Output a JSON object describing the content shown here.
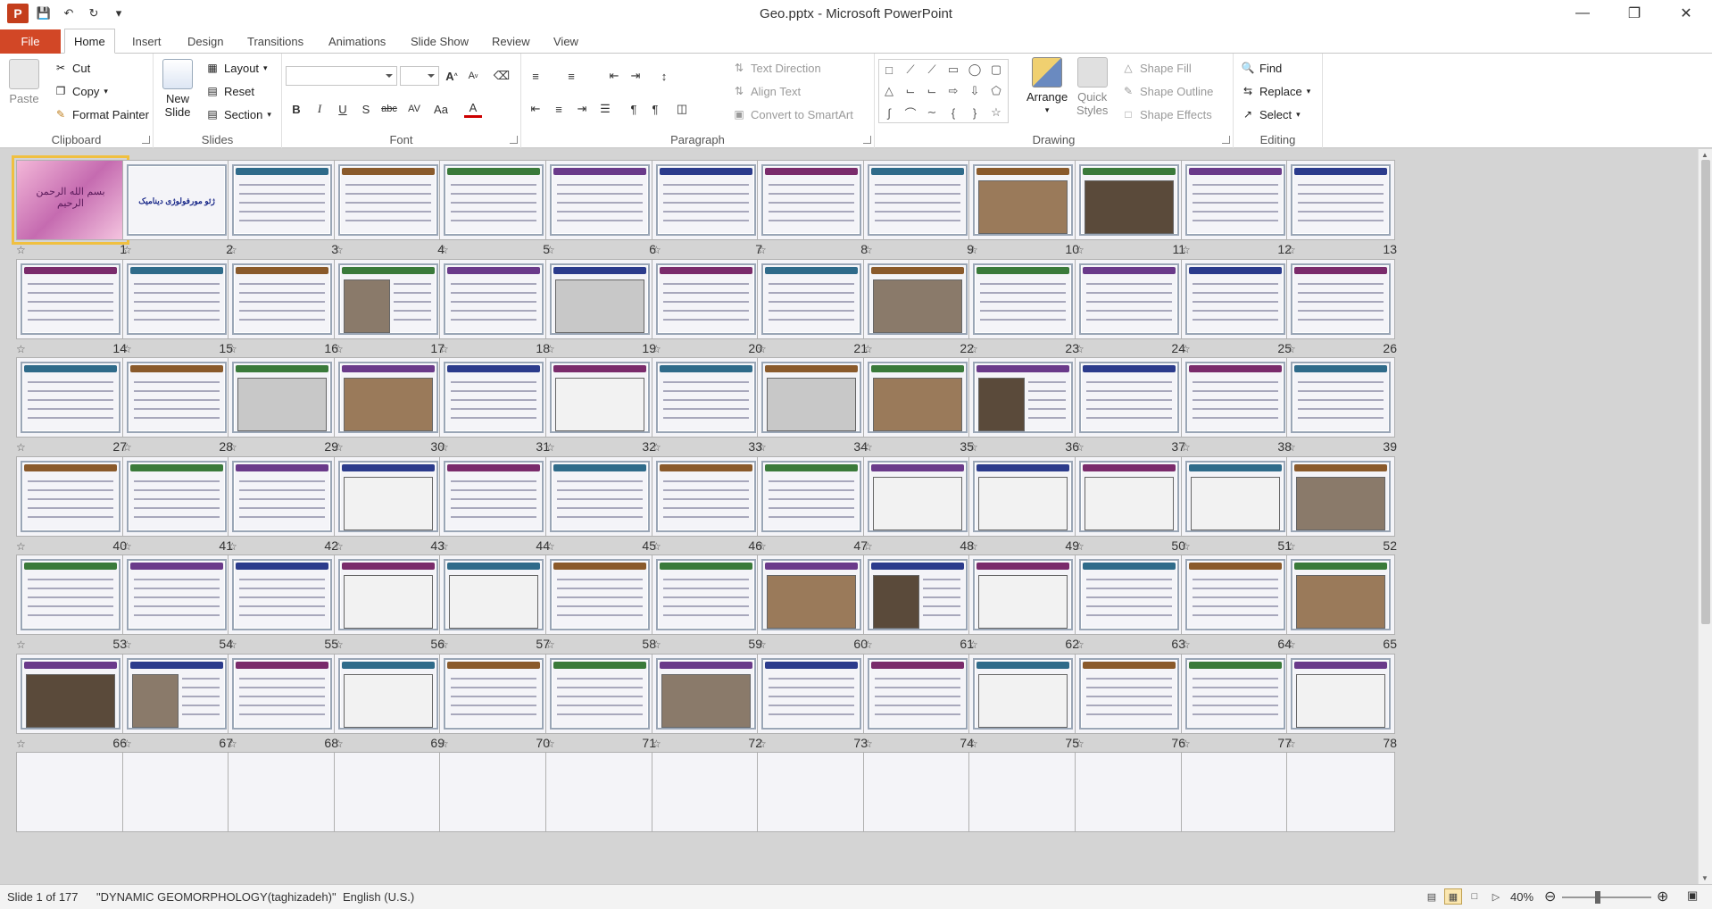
{
  "window": {
    "title": "Geo.pptx - Microsoft PowerPoint",
    "app_icon": "P",
    "controls": [
      "minimize",
      "restore",
      "close"
    ]
  },
  "quick_access": [
    "save-icon",
    "undo-icon",
    "redo-icon",
    "customize-icon"
  ],
  "tabs": [
    {
      "label": "File"
    },
    {
      "label": "Home",
      "active": true
    },
    {
      "label": "Insert"
    },
    {
      "label": "Design"
    },
    {
      "label": "Transitions"
    },
    {
      "label": "Animations"
    },
    {
      "label": "Slide Show"
    },
    {
      "label": "Review"
    },
    {
      "label": "View"
    }
  ],
  "ribbon": {
    "clipboard": {
      "label": "Clipboard",
      "paste": "Paste",
      "cut": "Cut",
      "copy": "Copy",
      "format_painter": "Format Painter"
    },
    "slides": {
      "label": "Slides",
      "new_slide_line1": "New",
      "new_slide_line2": "Slide",
      "layout": "Layout",
      "reset": "Reset",
      "section": "Section"
    },
    "font": {
      "label": "Font",
      "font_name": "",
      "font_size": "",
      "bold": "B",
      "italic": "I",
      "underline": "U",
      "strike": "S",
      "spacing": "AV",
      "case": "Aa",
      "color": "A",
      "grow": "A",
      "shrink": "A"
    },
    "paragraph": {
      "label": "Paragraph",
      "text_direction": "Text Direction",
      "align_text": "Align Text",
      "convert_smartart": "Convert to SmartArt"
    },
    "drawing": {
      "label": "Drawing",
      "arrange": "Arrange",
      "quick_styles_line1": "Quick",
      "quick_styles_line2": "Styles",
      "shape_fill": "Shape Fill",
      "shape_outline": "Shape Outline",
      "shape_effects": "Shape Effects"
    },
    "editing": {
      "label": "Editing",
      "find": "Find",
      "replace": "Replace",
      "select": "Select"
    }
  },
  "sorter": {
    "slides_visible": [
      "1",
      "2",
      "3",
      "4",
      "5",
      "6",
      "7",
      "8",
      "9",
      "10",
      "11",
      "12",
      "13",
      "14",
      "15",
      "16",
      "17",
      "18",
      "19",
      "20",
      "21",
      "22",
      "23",
      "24",
      "25",
      "26",
      "27",
      "28",
      "29",
      "30",
      "31",
      "32",
      "33",
      "34",
      "35",
      "36",
      "37",
      "38",
      "39",
      "40",
      "41",
      "42",
      "43",
      "44",
      "45",
      "46",
      "47",
      "48",
      "49",
      "50",
      "51",
      "52",
      "53",
      "54",
      "55",
      "56",
      "57",
      "58",
      "59",
      "60",
      "61",
      "62",
      "63",
      "64",
      "65",
      "66",
      "67",
      "68",
      "69",
      "70",
      "71",
      "72",
      "73",
      "74",
      "75",
      "76",
      "77",
      "78"
    ],
    "selected": "1",
    "slide1_title": "بسم الله الرحمن الرحیم",
    "slide2_title": "ژئو مورفولوژی دینامیک"
  },
  "status": {
    "slide_info": "Slide 1 of 177",
    "theme": "\"DYNAMIC GEOMORPHOLOGY(taghizadeh)\"",
    "language": "English (U.S.)",
    "zoom": "40%",
    "zoom_fraction": 0.4
  },
  "colors": {
    "file_tab": "#d24726",
    "selected_outline": "#f0c040",
    "workspace": "#d4d4d4"
  }
}
